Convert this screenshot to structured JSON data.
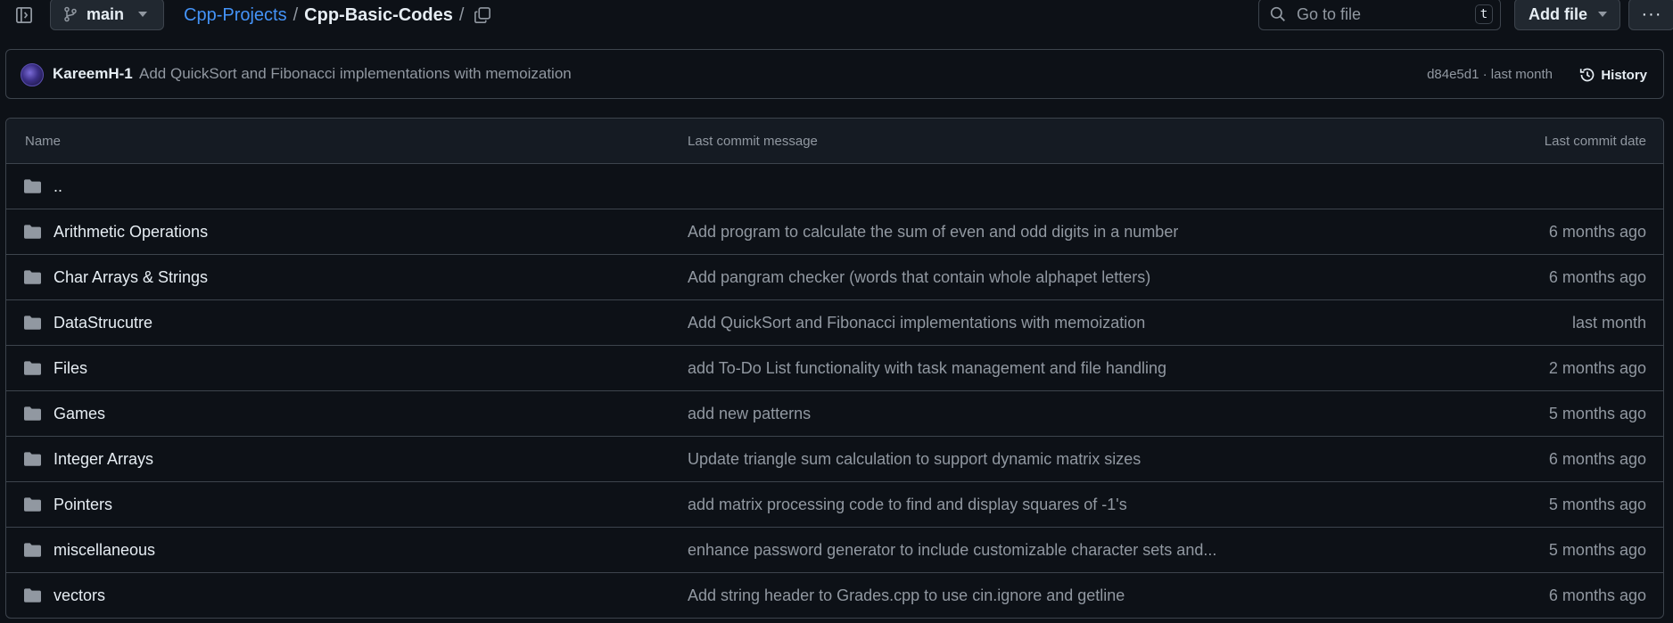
{
  "topbar": {
    "branch": "main",
    "breadcrumb": {
      "repo": "Cpp-Projects",
      "separator": "/",
      "current": "Cpp-Basic-Codes",
      "trailing": "/"
    },
    "goto_placeholder": "Go to file",
    "goto_shortcut": "t",
    "add_file_label": "Add file",
    "more_label": "···"
  },
  "commit": {
    "author": "KareemH-1",
    "message": "Add QuickSort and Fibonacci implementations with memoization",
    "hash_and_time": "d84e5d1 · last month",
    "history_label": "History"
  },
  "table": {
    "headers": {
      "name": "Name",
      "message": "Last commit message",
      "date": "Last commit date"
    },
    "rows": [
      {
        "name": "..",
        "message": "",
        "date": ""
      },
      {
        "name": "Arithmetic Operations",
        "message": "Add program to calculate the sum of even and odd digits in a number",
        "date": "6 months ago"
      },
      {
        "name": "Char Arrays & Strings",
        "message": "Add pangram checker (words that contain whole alphapet letters)",
        "date": "6 months ago"
      },
      {
        "name": "DataStrucutre",
        "message": "Add QuickSort and Fibonacci implementations with memoization",
        "date": "last month"
      },
      {
        "name": "Files",
        "message": "add To-Do List functionality with task management and file handling",
        "date": "2 months ago"
      },
      {
        "name": "Games",
        "message": "add new patterns",
        "date": "5 months ago"
      },
      {
        "name": "Integer Arrays",
        "message": "Update triangle sum calculation to support dynamic matrix sizes",
        "date": "6 months ago"
      },
      {
        "name": "Pointers",
        "message": "add matrix processing code to find and display squares of -1's",
        "date": "5 months ago"
      },
      {
        "name": "miscellaneous",
        "message": "enhance password generator to include customizable character sets and...",
        "date": "5 months ago"
      },
      {
        "name": "vectors",
        "message": "Add string header to Grades.cpp to use cin.ignore and getline",
        "date": "6 months ago"
      }
    ]
  },
  "colors": {
    "background": "#0d1117",
    "border": "#3d444d",
    "link": "#4493f8",
    "muted": "#9198a1",
    "text": "#e6edf3",
    "folder": "#9198a1"
  }
}
